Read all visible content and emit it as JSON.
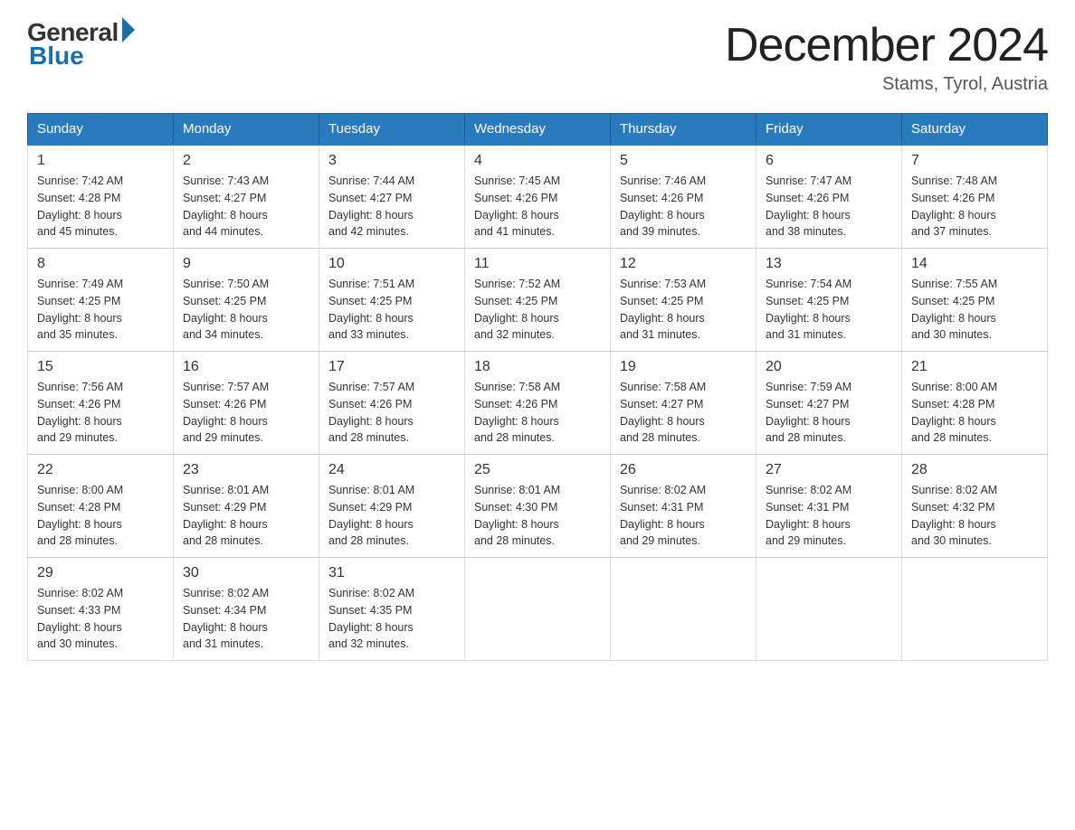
{
  "header": {
    "logo_general": "General",
    "logo_blue": "Blue",
    "month_title": "December 2024",
    "location": "Stams, Tyrol, Austria"
  },
  "weekdays": [
    "Sunday",
    "Monday",
    "Tuesday",
    "Wednesday",
    "Thursday",
    "Friday",
    "Saturday"
  ],
  "weeks": [
    [
      {
        "day": "1",
        "sunrise": "7:42 AM",
        "sunset": "4:28 PM",
        "daylight": "8 hours and 45 minutes."
      },
      {
        "day": "2",
        "sunrise": "7:43 AM",
        "sunset": "4:27 PM",
        "daylight": "8 hours and 44 minutes."
      },
      {
        "day": "3",
        "sunrise": "7:44 AM",
        "sunset": "4:27 PM",
        "daylight": "8 hours and 42 minutes."
      },
      {
        "day": "4",
        "sunrise": "7:45 AM",
        "sunset": "4:26 PM",
        "daylight": "8 hours and 41 minutes."
      },
      {
        "day": "5",
        "sunrise": "7:46 AM",
        "sunset": "4:26 PM",
        "daylight": "8 hours and 39 minutes."
      },
      {
        "day": "6",
        "sunrise": "7:47 AM",
        "sunset": "4:26 PM",
        "daylight": "8 hours and 38 minutes."
      },
      {
        "day": "7",
        "sunrise": "7:48 AM",
        "sunset": "4:26 PM",
        "daylight": "8 hours and 37 minutes."
      }
    ],
    [
      {
        "day": "8",
        "sunrise": "7:49 AM",
        "sunset": "4:25 PM",
        "daylight": "8 hours and 35 minutes."
      },
      {
        "day": "9",
        "sunrise": "7:50 AM",
        "sunset": "4:25 PM",
        "daylight": "8 hours and 34 minutes."
      },
      {
        "day": "10",
        "sunrise": "7:51 AM",
        "sunset": "4:25 PM",
        "daylight": "8 hours and 33 minutes."
      },
      {
        "day": "11",
        "sunrise": "7:52 AM",
        "sunset": "4:25 PM",
        "daylight": "8 hours and 32 minutes."
      },
      {
        "day": "12",
        "sunrise": "7:53 AM",
        "sunset": "4:25 PM",
        "daylight": "8 hours and 31 minutes."
      },
      {
        "day": "13",
        "sunrise": "7:54 AM",
        "sunset": "4:25 PM",
        "daylight": "8 hours and 31 minutes."
      },
      {
        "day": "14",
        "sunrise": "7:55 AM",
        "sunset": "4:25 PM",
        "daylight": "8 hours and 30 minutes."
      }
    ],
    [
      {
        "day": "15",
        "sunrise": "7:56 AM",
        "sunset": "4:26 PM",
        "daylight": "8 hours and 29 minutes."
      },
      {
        "day": "16",
        "sunrise": "7:57 AM",
        "sunset": "4:26 PM",
        "daylight": "8 hours and 29 minutes."
      },
      {
        "day": "17",
        "sunrise": "7:57 AM",
        "sunset": "4:26 PM",
        "daylight": "8 hours and 28 minutes."
      },
      {
        "day": "18",
        "sunrise": "7:58 AM",
        "sunset": "4:26 PM",
        "daylight": "8 hours and 28 minutes."
      },
      {
        "day": "19",
        "sunrise": "7:58 AM",
        "sunset": "4:27 PM",
        "daylight": "8 hours and 28 minutes."
      },
      {
        "day": "20",
        "sunrise": "7:59 AM",
        "sunset": "4:27 PM",
        "daylight": "8 hours and 28 minutes."
      },
      {
        "day": "21",
        "sunrise": "8:00 AM",
        "sunset": "4:28 PM",
        "daylight": "8 hours and 28 minutes."
      }
    ],
    [
      {
        "day": "22",
        "sunrise": "8:00 AM",
        "sunset": "4:28 PM",
        "daylight": "8 hours and 28 minutes."
      },
      {
        "day": "23",
        "sunrise": "8:01 AM",
        "sunset": "4:29 PM",
        "daylight": "8 hours and 28 minutes."
      },
      {
        "day": "24",
        "sunrise": "8:01 AM",
        "sunset": "4:29 PM",
        "daylight": "8 hours and 28 minutes."
      },
      {
        "day": "25",
        "sunrise": "8:01 AM",
        "sunset": "4:30 PM",
        "daylight": "8 hours and 28 minutes."
      },
      {
        "day": "26",
        "sunrise": "8:02 AM",
        "sunset": "4:31 PM",
        "daylight": "8 hours and 29 minutes."
      },
      {
        "day": "27",
        "sunrise": "8:02 AM",
        "sunset": "4:31 PM",
        "daylight": "8 hours and 29 minutes."
      },
      {
        "day": "28",
        "sunrise": "8:02 AM",
        "sunset": "4:32 PM",
        "daylight": "8 hours and 30 minutes."
      }
    ],
    [
      {
        "day": "29",
        "sunrise": "8:02 AM",
        "sunset": "4:33 PM",
        "daylight": "8 hours and 30 minutes."
      },
      {
        "day": "30",
        "sunrise": "8:02 AM",
        "sunset": "4:34 PM",
        "daylight": "8 hours and 31 minutes."
      },
      {
        "day": "31",
        "sunrise": "8:02 AM",
        "sunset": "4:35 PM",
        "daylight": "8 hours and 32 minutes."
      },
      null,
      null,
      null,
      null
    ]
  ],
  "labels": {
    "sunrise": "Sunrise:",
    "sunset": "Sunset:",
    "daylight": "Daylight:"
  }
}
